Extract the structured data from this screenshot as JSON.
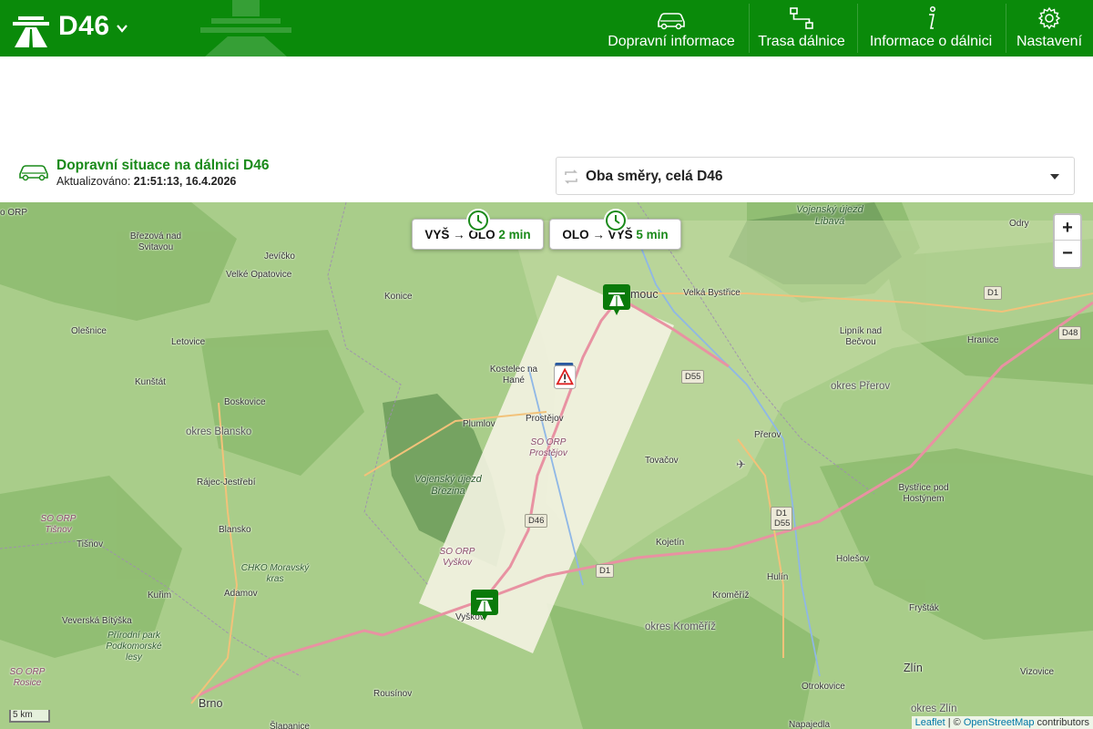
{
  "header": {
    "title": "D46",
    "brand_color": "#0a8a0a",
    "nav": [
      {
        "label": "Dopravní informace",
        "icon": "car-icon"
      },
      {
        "label": "Trasa dálnice",
        "icon": "route-icon"
      },
      {
        "label": "Informace o dálnici",
        "icon": "info-icon"
      },
      {
        "label": "Nastavení",
        "icon": "gear-icon"
      }
    ]
  },
  "info": {
    "title": "Dopravní situace na dálnici D46",
    "updated_label": "Aktualizováno:",
    "updated_value": "21:51:13, 16.4.2026",
    "direction_select": "Oba směry, celá D46"
  },
  "map": {
    "travel_times": [
      {
        "route": "VYŠ → OLO",
        "time": "2 min"
      },
      {
        "route": "OLO → VYŠ",
        "time": "5 min"
      }
    ],
    "zoom_in": "+",
    "zoom_out": "−",
    "scale": "5 km",
    "attribution": {
      "leaflet": "Leaflet",
      "sep": " | © ",
      "osm": "OpenStreetMap",
      "tail": " contributors"
    },
    "labels": {
      "orp1": "o ORP",
      "brezova": "Březová nad Svitavou",
      "jevicko": "Jevíčko",
      "velke_opatovice": "Velké Opatovice",
      "konice": "Konice",
      "olesnice": "Olešnice",
      "letovice": "Letovice",
      "kunstat": "Kunštát",
      "boskovice": "Boskovice",
      "okres_blansko": "okres Blansko",
      "rajec": "Rájec-Jestřebí",
      "so_tisnov": "SO ORP Tišnov",
      "blansko": "Blansko",
      "tisnov": "Tišnov",
      "chko": "CHKO Moravský kras",
      "kurim": "Kuřim",
      "adamov": "Adamov",
      "veverska": "Veverská Bítýška",
      "prirodni": "Přírodní park Podkomorské lesy",
      "so_rosice": "SO ORP Rosice",
      "brno": "Brno",
      "rousinov": "Rousínov",
      "slapanice": "Šlapanice",
      "kostelec": "Kostelec na Hané",
      "plumlov": "Plumlov",
      "prostejov": "Prostějov",
      "so_prostejov": "SO ORP Prostějov",
      "vojensky_brezina": "Vojenský újezd Březina",
      "so_vyskov": "SO ORP Vyškov",
      "vyskov": "Vyškov",
      "olomouc": "mouc",
      "velka_bystrice": "Velká Bystřice",
      "vojensky_libava": "Vojenský újezd Libavá",
      "odry": "Odry",
      "olomouc_top": "ouc",
      "hranice": "Hranice",
      "lipnik": "Lipník nad Bečvou",
      "okres_prerov": "okres Přerov",
      "prerov": "Přerov",
      "tovacov": "Tovačov",
      "bystrice_hostyn": "Bystřice pod Hostýnem",
      "kojetin": "Kojetín",
      "holesov": "Holešov",
      "hulin": "Hulín",
      "kromeriz": "Kroměříž",
      "okres_kromeriz": "okres Kroměříž",
      "frystak": "Fryšták",
      "zlin": "Zlín",
      "vizovice": "Vizovice",
      "otrokovice": "Otrokovice",
      "okres_zlin": "okres Zlín",
      "napajedla": "Napajedla"
    },
    "shields": [
      "D46",
      "D1",
      "D55",
      "D1",
      "D48",
      "D1 D55"
    ]
  }
}
